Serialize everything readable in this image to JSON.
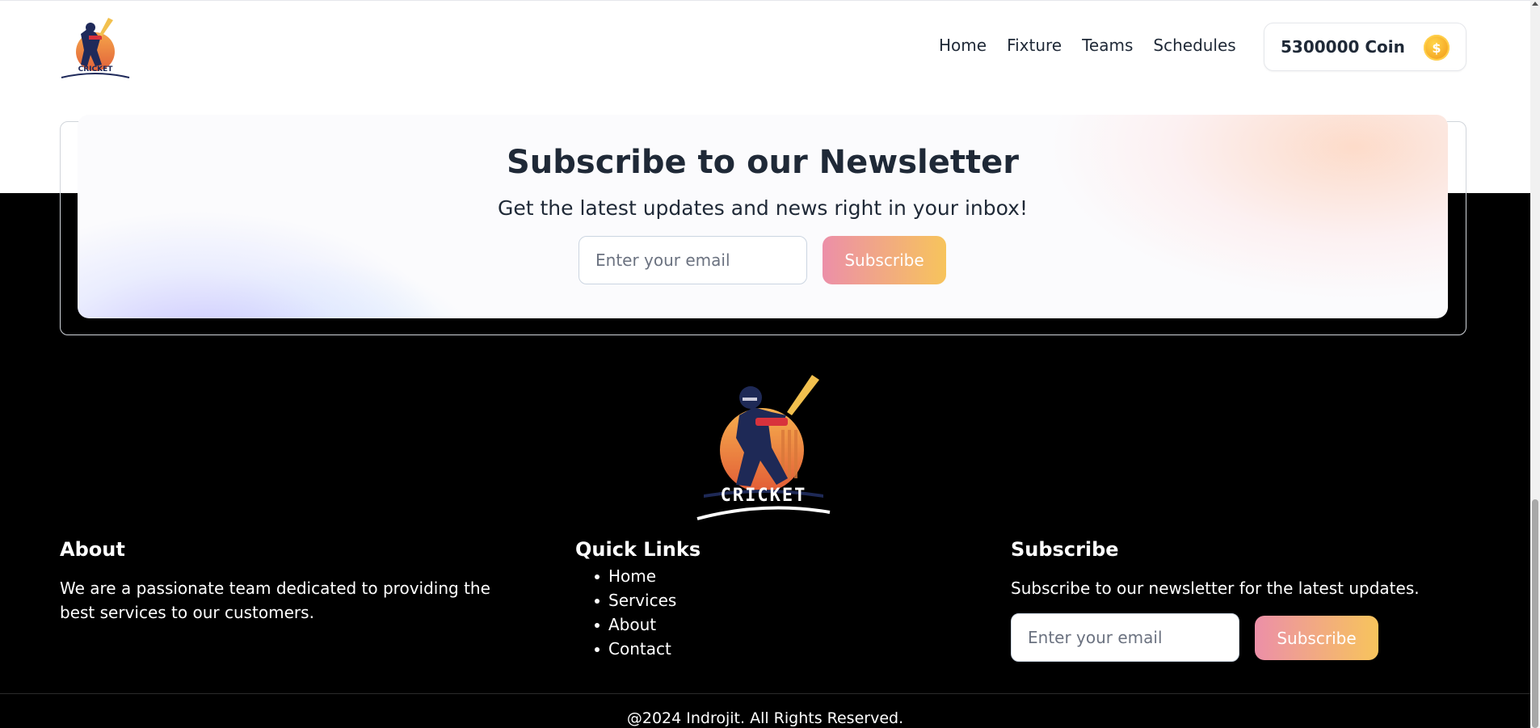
{
  "navbar": {
    "logo_text": "CRICKET",
    "links": [
      "Home",
      "Fixture",
      "Teams",
      "Schedules"
    ],
    "coin_label": "5300000 Coin",
    "coin_icon": "dollar-coin-icon"
  },
  "newsletter": {
    "title": "Subscribe to our Newsletter",
    "subtitle": "Get the latest updates and news right in your inbox!",
    "email_placeholder": "Enter your email",
    "button_label": "Subscribe"
  },
  "footer": {
    "logo_text": "CRICKET",
    "about": {
      "heading": "About",
      "text": "We are a passionate team dedicated to providing the best services to our customers."
    },
    "quick_links": {
      "heading": "Quick Links",
      "items": [
        "Home",
        "Services",
        "About",
        "Contact"
      ]
    },
    "subscribe": {
      "heading": "Subscribe",
      "text": "Subscribe to our newsletter for the latest updates.",
      "email_placeholder": "Enter your email",
      "button_label": "Subscribe"
    },
    "copyright": "@2024 Indrojit. All Rights Reserved."
  },
  "colors": {
    "button_gradient_start": "#ec8fa8",
    "button_gradient_end": "#f7c45c",
    "footer_bg": "#000000",
    "text_dark": "#1f2937"
  }
}
